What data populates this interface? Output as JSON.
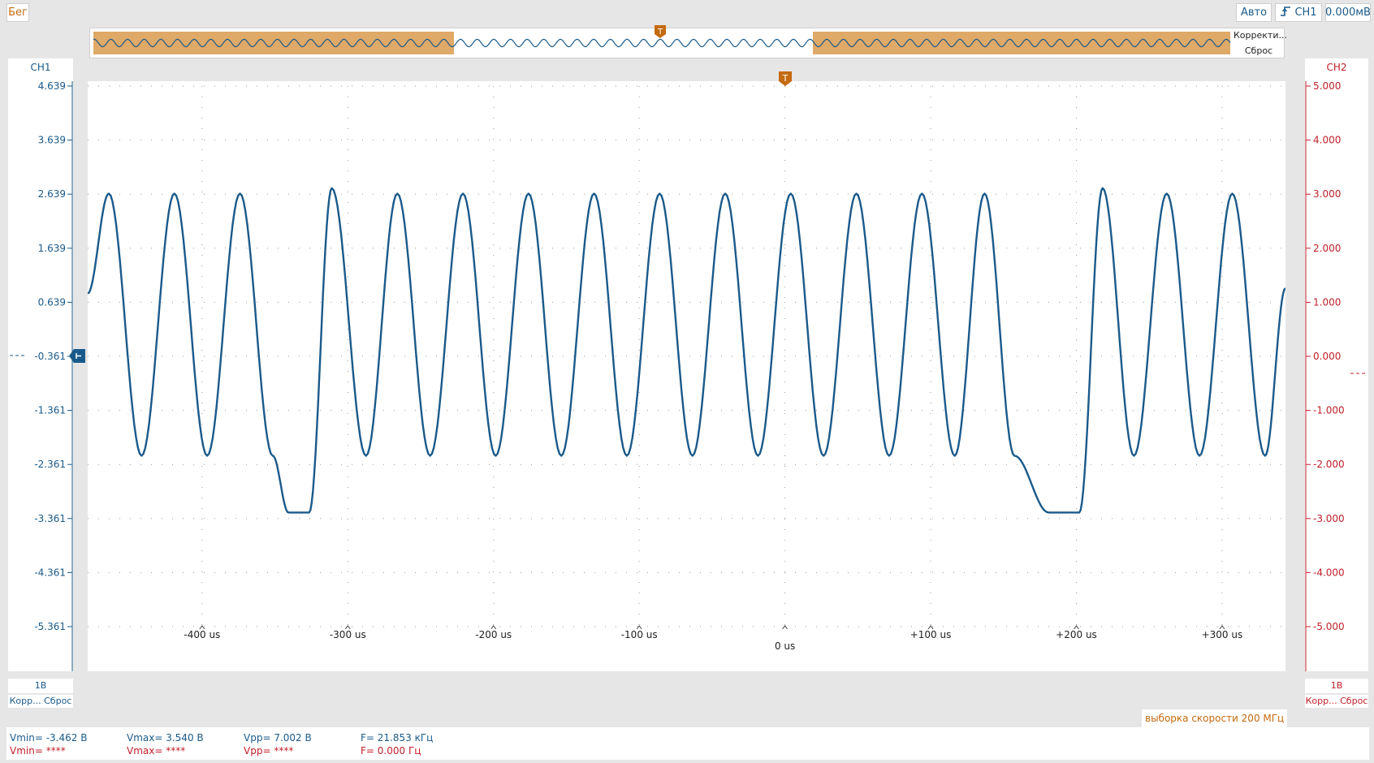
{
  "toolbar": {
    "run_label": "Бег",
    "mode_label": "Авто",
    "trigger_source": "CH1",
    "trigger_level": "0.000мВ"
  },
  "overview": {
    "correct_label": "Корректи...",
    "reset_label": "Сброс",
    "trigger_marker": "T"
  },
  "channels": {
    "ch1": {
      "name": "CH1",
      "scale": "1В",
      "correct": "Корр...",
      "reset": "Сброс",
      "color": "#1a5a8a"
    },
    "ch2": {
      "name": "CH2",
      "scale": "1В",
      "correct": "Корр...",
      "reset": "Сброс",
      "color": "#c0202a"
    }
  },
  "sample_rate": "выборка скорости 200 МГц",
  "measurements": {
    "ch1": {
      "vmin": "Vmin= -3.462 В",
      "vmax": "Vmax= 3.540 В",
      "vpp": "Vpp= 7.002 В",
      "freq": "F= 21.853 кГц"
    },
    "ch2": {
      "vmin": "Vmin= ****",
      "vmax": "Vmax= ****",
      "vpp": "Vpp= ****",
      "freq": "F= 0.000 Гц"
    }
  },
  "chart_data": {
    "type": "line",
    "title": "",
    "y_left_ticks": [
      "4.639",
      "3.639",
      "2.639",
      "1.639",
      "0.639",
      "-0.361",
      "-1.361",
      "-2.361",
      "-3.361",
      "-4.361",
      "-5.361"
    ],
    "y_right_ticks": [
      "5.000",
      "4.000",
      "3.000",
      "2.000",
      "1.000",
      "0.000",
      "-1.000",
      "-2.000",
      "-3.000",
      "-4.000",
      "-5.000"
    ],
    "ylim_left": [
      -5.361,
      4.639
    ],
    "ylim_right": [
      -5.0,
      5.0
    ],
    "x_ticks": [
      {
        "value": -400,
        "label": "-400 us"
      },
      {
        "value": -300,
        "label": "-300 us"
      },
      {
        "value": -200,
        "label": "-200 us"
      },
      {
        "value": -100,
        "label": "-100 us"
      },
      {
        "value": 0,
        "label": "0 us"
      },
      {
        "value": 100,
        "label": "+100 us"
      },
      {
        "value": 200,
        "label": "+200 us"
      },
      {
        "value": 300,
        "label": "+300 us"
      }
    ],
    "xlim": [
      -478.5,
      343.5
    ],
    "grid": true,
    "series": [
      {
        "channel": "CH1",
        "color": "#1a5a8a",
        "x_us": [
          -478.5,
          -464,
          -441.5,
          -419,
          -396.5,
          -374,
          -351.5,
          -340.7,
          -326.5,
          -311,
          -287.5,
          -266,
          -243.5,
          -221,
          -198.5,
          -176,
          -153.5,
          -131,
          -108.5,
          -86,
          -63.5,
          -41,
          -18.5,
          4,
          26.5,
          49,
          71.5,
          94,
          116.5,
          137,
          157.5,
          181,
          202,
          218,
          239.5,
          262,
          284.5,
          307,
          329.5,
          343.5
        ],
        "y_volts": [
          0.8,
          2.65,
          -2.2,
          2.65,
          -2.2,
          2.65,
          -2.2,
          -3.25,
          -3.25,
          2.75,
          -2.2,
          2.65,
          -2.2,
          2.65,
          -2.2,
          2.65,
          -2.2,
          2.65,
          -2.2,
          2.65,
          -2.2,
          2.65,
          -2.2,
          2.65,
          -2.2,
          2.65,
          -2.2,
          2.65,
          -2.2,
          2.65,
          -2.2,
          -3.25,
          -3.25,
          2.75,
          -2.2,
          2.65,
          -2.2,
          2.65,
          -2.2,
          0.9
        ]
      }
    ]
  }
}
